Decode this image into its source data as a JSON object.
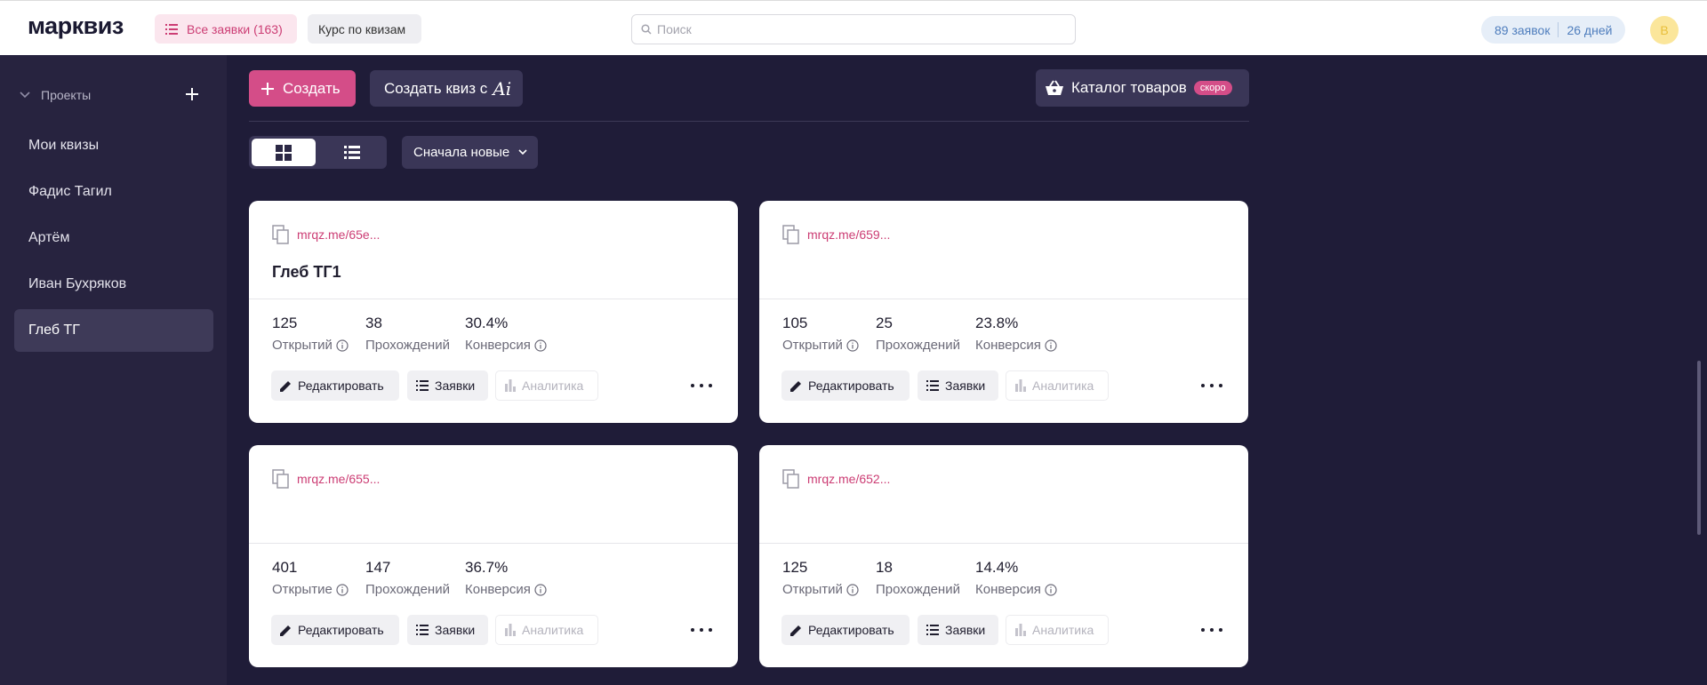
{
  "header": {
    "logo": "марквиз",
    "all_requests_label": "Все заявки (163)",
    "course_label": "Курс по квизам",
    "search_placeholder": "Поиск",
    "plan_requests": "89 заявок",
    "plan_days": "26 дней",
    "avatar_letter": "B"
  },
  "sidebar": {
    "projects_label": "Проекты",
    "items": [
      {
        "label": "Мои квизы"
      },
      {
        "label": "Фадис Тагил"
      },
      {
        "label": "Артём"
      },
      {
        "label": "Иван Бухряков"
      },
      {
        "label": "Глеб ТГ"
      }
    ]
  },
  "toolbar": {
    "create_label": "Создать",
    "create_ai_label": "Создать квиз с",
    "ai_glyph": "Ai",
    "catalog_label": "Каталог товаров",
    "soon_badge": "скоро",
    "sort_label": "Сначала новые"
  },
  "cards": [
    {
      "link": "mrqz.me/65e...",
      "title": "Глеб ТГ1",
      "opens_value": "125",
      "opens_label": "Открытий",
      "completions_value": "38",
      "completions_label": "Прохождений",
      "conversion_value": "30.4%",
      "conversion_label": "Конверсия",
      "edit_label": "Редактировать",
      "requests_label": "Заявки",
      "analytics_label": "Аналитика"
    },
    {
      "link": "mrqz.me/659...",
      "title": "",
      "opens_value": "105",
      "opens_label": "Открытий",
      "completions_value": "25",
      "completions_label": "Прохождений",
      "conversion_value": "23.8%",
      "conversion_label": "Конверсия",
      "edit_label": "Редактировать",
      "requests_label": "Заявки",
      "analytics_label": "Аналитика"
    },
    {
      "link": "mrqz.me/655...",
      "title": "",
      "opens_value": "401",
      "opens_label": "Открытие",
      "completions_value": "147",
      "completions_label": "Прохождений",
      "conversion_value": "36.7%",
      "conversion_label": "Конверсия",
      "edit_label": "Редактировать",
      "requests_label": "Заявки",
      "analytics_label": "Аналитика"
    },
    {
      "link": "mrqz.me/652...",
      "title": "",
      "opens_value": "125",
      "opens_label": "Открытий",
      "completions_value": "18",
      "completions_label": "Прохождений",
      "conversion_value": "14.4%",
      "conversion_label": "Конверсия",
      "edit_label": "Редактировать",
      "requests_label": "Заявки",
      "analytics_label": "Аналитика"
    }
  ],
  "colors": {
    "accent": "#d44d88",
    "sidebar_bg": "#27233f",
    "main_bg": "#1f1c38",
    "link": "#cc3d74"
  }
}
